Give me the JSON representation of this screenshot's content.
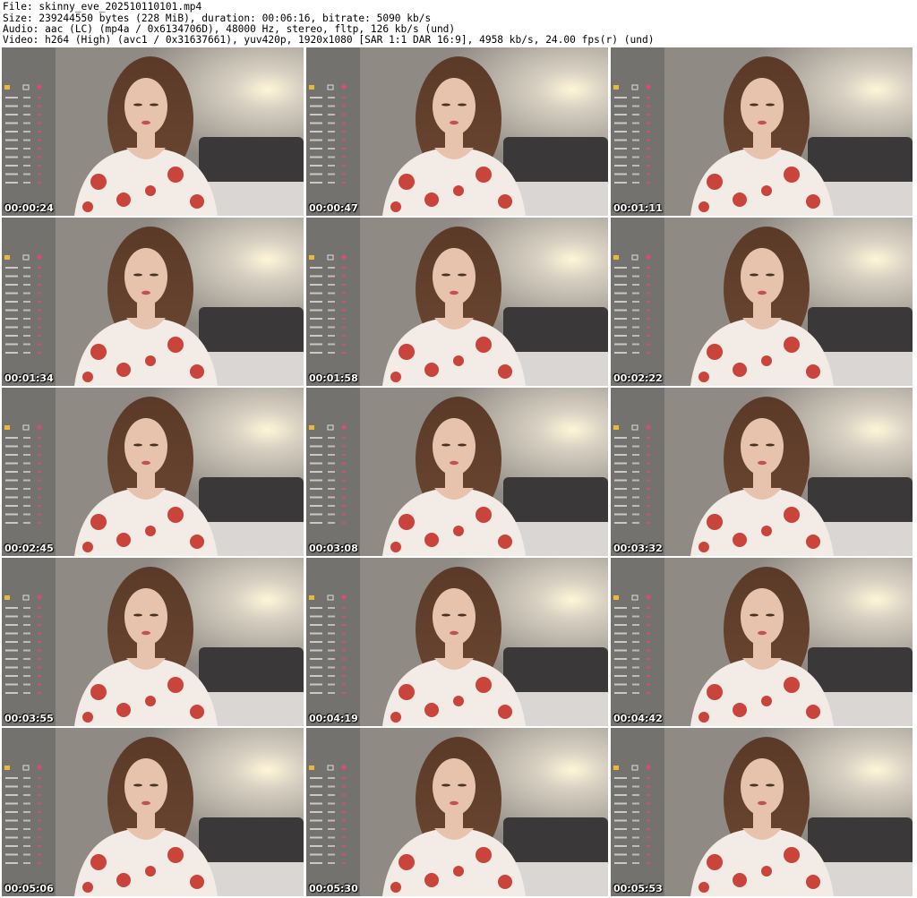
{
  "header": {
    "file": "File: skinny_eve_202510110101.mp4",
    "size": "Size: 239244550 bytes (228 MiB), duration: 00:06:16, bitrate: 5090 kb/s",
    "audio": "Audio: aac (LC) (mp4a / 0x6134706D), 48000 Hz, stereo, fltp, 126 kb/s (und)",
    "video": "Video: h264 (High) (avc1 / 0x31637661), yuv420p, 1920x1080 [SAR 1:1 DAR 16:9], 4958 kb/s, 24.00 fps(r) (und)"
  },
  "thumbnails": [
    {
      "timestamp": "00:00:24"
    },
    {
      "timestamp": "00:00:47"
    },
    {
      "timestamp": "00:01:11"
    },
    {
      "timestamp": "00:01:34"
    },
    {
      "timestamp": "00:01:58"
    },
    {
      "timestamp": "00:02:22"
    },
    {
      "timestamp": "00:02:45"
    },
    {
      "timestamp": "00:03:08"
    },
    {
      "timestamp": "00:03:32"
    },
    {
      "timestamp": "00:03:55"
    },
    {
      "timestamp": "00:04:19"
    },
    {
      "timestamp": "00:04:42"
    },
    {
      "timestamp": "00:05:06"
    },
    {
      "timestamp": "00:05:30"
    },
    {
      "timestamp": "00:05:53"
    }
  ],
  "colors": {
    "wall": "#8f8a84",
    "lamp": "#fff6d8",
    "hair": "#6b4631",
    "skin": "#e7c2ac",
    "dress": "#f3ebe6",
    "flower": "#c9443a",
    "headboard": "#3a3838",
    "overlay_accent": "#e0487a"
  }
}
